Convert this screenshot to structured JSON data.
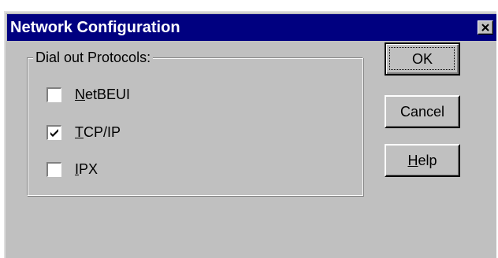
{
  "window": {
    "title": "Network Configuration",
    "close_icon": "close-icon"
  },
  "group": {
    "label": "Dial out Protocols:"
  },
  "protocols": [
    {
      "mnemonic": "N",
      "rest": "etBEUI",
      "checked": false
    },
    {
      "mnemonic": "T",
      "rest": "CP/IP",
      "checked": true
    },
    {
      "mnemonic": "I",
      "rest": "PX",
      "checked": false
    }
  ],
  "buttons": {
    "ok": "OK",
    "cancel": "Cancel",
    "help_mnemonic": "H",
    "help_rest": "elp"
  },
  "colors": {
    "titlebar": "#000080",
    "face": "#c0c0c0"
  }
}
